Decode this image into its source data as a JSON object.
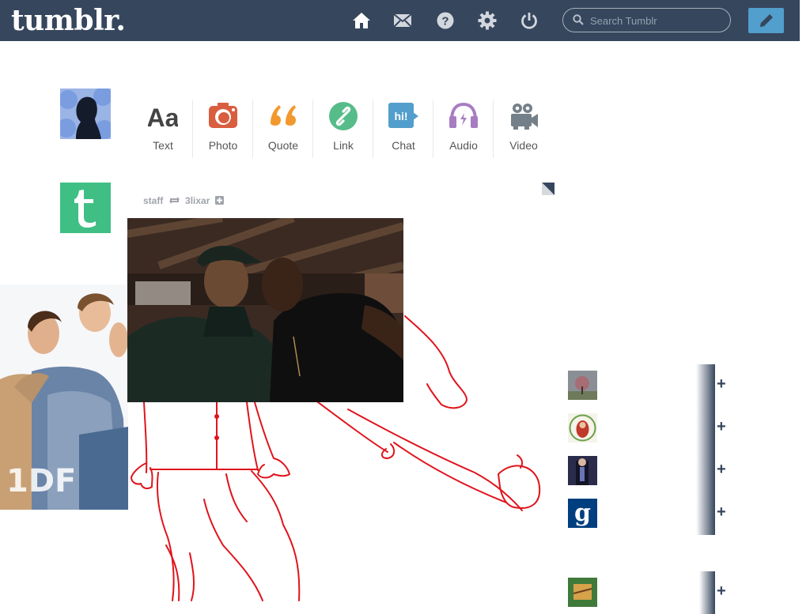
{
  "header": {
    "logo": "tumblr.",
    "search_placeholder": "Search Tumblr",
    "nav_icons": [
      "home-icon",
      "mail-icon",
      "help-icon",
      "gear-icon",
      "power-icon"
    ],
    "compose_icon": "pencil-icon"
  },
  "post_types": [
    {
      "label": "Text",
      "icon": "text-icon",
      "color": "#444444"
    },
    {
      "label": "Photo",
      "icon": "camera-icon",
      "color": "#d95e40"
    },
    {
      "label": "Quote",
      "icon": "quote-icon",
      "color": "#f2992e"
    },
    {
      "label": "Link",
      "icon": "link-icon",
      "color": "#56bc8a"
    },
    {
      "label": "Chat",
      "icon": "chat-icon",
      "color": "#529ecc",
      "badge": "hi!"
    },
    {
      "label": "Audio",
      "icon": "headphones-icon",
      "color": "#a77dc2"
    },
    {
      "label": "Video",
      "icon": "video-camera-icon",
      "color": "#748089"
    }
  ],
  "post": {
    "author": "staff",
    "reblogged_from": "3lixar",
    "reblog_icon": "reblog-icon",
    "watermark": "1DF"
  },
  "colors": {
    "header_bg": "#36465d",
    "accent": "#529ecc",
    "drawing_red": "#e0141c",
    "staff_green": "#3fbf84"
  }
}
